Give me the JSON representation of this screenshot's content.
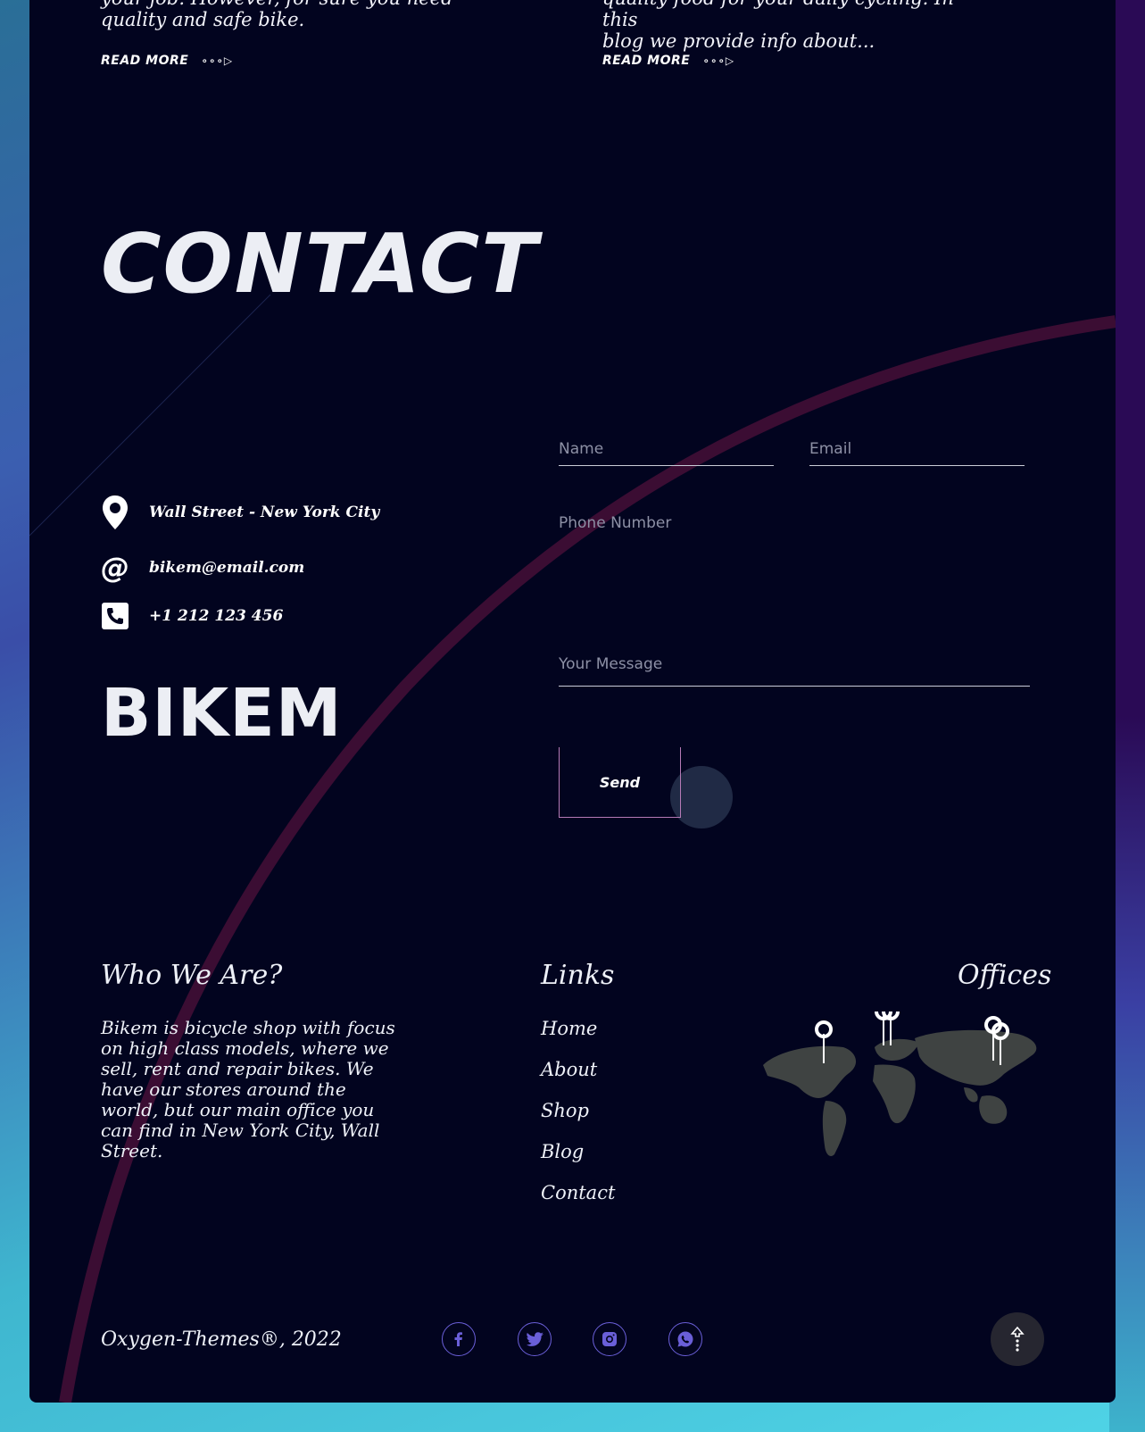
{
  "blog": {
    "posts": [
      {
        "excerpt_line1": "your job. However, for sure you need",
        "excerpt_line2": "quality and safe bike.",
        "read_more": "READ MORE"
      },
      {
        "excerpt_line1": "quality food for your daily cycling. In this",
        "excerpt_line2": "blog we provide info about...",
        "read_more": "READ MORE"
      }
    ]
  },
  "contact": {
    "title": "CONTACT",
    "address": "Wall Street - New York City",
    "email": "bikem@email.com",
    "phone": "+1 212 123 456",
    "brand": "BIKEM",
    "form": {
      "name_placeholder": "Name",
      "email_placeholder": "Email",
      "phone_placeholder": "Phone Number",
      "message_placeholder": "Your Message",
      "send_label": "Send"
    }
  },
  "footer": {
    "who_heading": "Who We Are?",
    "who_text": "Bikem is bicycle shop with focus on high class models, where we sell, rent and repair bikes. We have our stores around the world, but our main office you can find in New York City, Wall Street.",
    "links_heading": "Links",
    "links": [
      "Home",
      "About",
      "Shop",
      "Blog",
      "Contact"
    ],
    "offices_heading": "Offices",
    "copyright": "Oxygen-Themes®, 2022",
    "social": [
      "facebook-icon",
      "twitter-icon",
      "instagram-icon",
      "whatsapp-icon"
    ]
  },
  "colors": {
    "panel_bg": "#02041f",
    "accent_arc": "#3b0d33",
    "social_border": "#6a5fd8",
    "send_border": "#b57ab6",
    "map_land": "#3f4342"
  }
}
